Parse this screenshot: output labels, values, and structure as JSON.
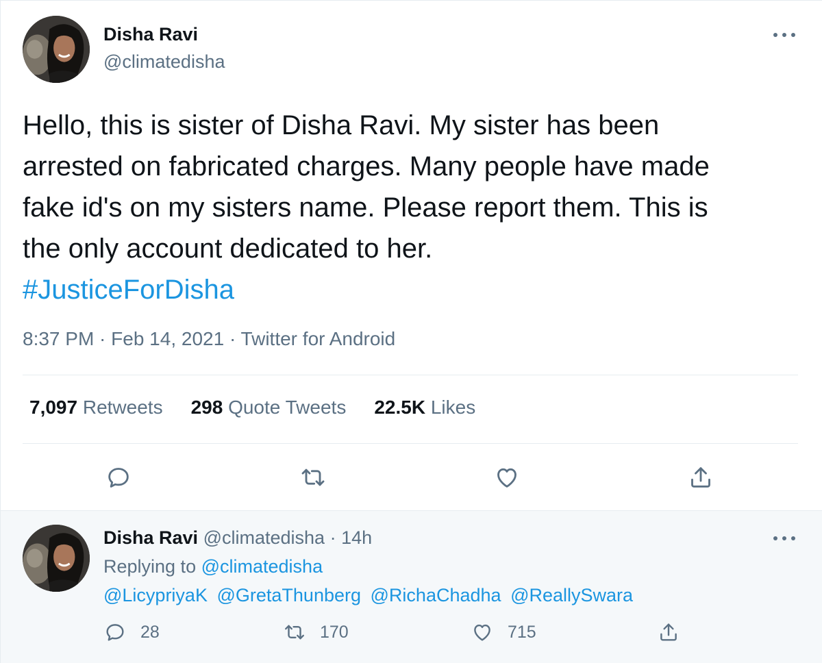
{
  "tweet": {
    "author": {
      "name": "Disha Ravi",
      "handle": "@climatedisha"
    },
    "more_label": "More",
    "text_lines": [
      "Hello, this is sister of Disha Ravi. My sister has been",
      "arrested on fabricated charges. Many people have made",
      "fake id's on my sisters name. Please report them. This is",
      "the only account dedicated to her."
    ],
    "hashtag": "#JusticeForDisha",
    "meta": "8:37 PM · Feb 14, 2021 · Twitter for Android",
    "stats": [
      {
        "value": "7,097",
        "label": "Retweets"
      },
      {
        "value": "298",
        "label": "Quote Tweets"
      },
      {
        "value": "22.5K",
        "label": "Likes"
      }
    ],
    "actions": [
      "reply",
      "retweet",
      "like",
      "share"
    ]
  },
  "reply": {
    "author": {
      "name": "Disha Ravi",
      "handle": "@climatedisha"
    },
    "time": "14h",
    "separator": "·",
    "replying_prefix": "Replying to",
    "replying_to": "@climatedisha",
    "mentions": [
      "@LicypriyaK",
      "@GretaThunberg",
      "@RichaChadha",
      "@ReallySwara"
    ],
    "counts": {
      "replies": "28",
      "retweets": "170",
      "likes": "715"
    }
  },
  "colors": {
    "text": "#0f1419",
    "secondary": "#5b7083",
    "link": "#1b95e0",
    "reply_bg": "#f5f8fa",
    "divider": "#e6ecf0"
  }
}
